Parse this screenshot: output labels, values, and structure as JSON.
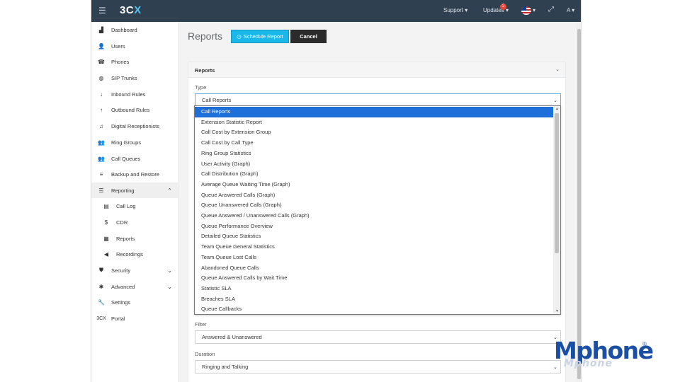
{
  "topbar": {
    "menu_icon": "hamburger-icon",
    "logo_main": "3C",
    "logo_x": "X",
    "support": "Support ▾",
    "updates": "Updates ▾",
    "updates_badge": "2",
    "language_caret": "▾",
    "fullscreen_icon": "⤢",
    "user": "A ▾"
  },
  "sidebar": {
    "items": [
      {
        "icon": "bar-chart-icon",
        "glyph": "▟",
        "label": "Dashboard"
      },
      {
        "icon": "user-icon",
        "glyph": "👤",
        "label": "Users"
      },
      {
        "icon": "phone-icon",
        "glyph": "☎",
        "label": "Phones"
      },
      {
        "icon": "globe-icon",
        "glyph": "◍",
        "label": "SIP Trunks"
      },
      {
        "icon": "arrow-down-icon",
        "glyph": "↓",
        "label": "Inbound Rules"
      },
      {
        "icon": "arrow-up-icon",
        "glyph": "↑",
        "label": "Outbound Rules"
      },
      {
        "icon": "headset-icon",
        "glyph": "♫",
        "label": "Digital Receptionists"
      },
      {
        "icon": "group-icon",
        "glyph": "👥",
        "label": "Ring Groups"
      },
      {
        "icon": "queue-icon",
        "glyph": "👥",
        "label": "Call Queues"
      },
      {
        "icon": "database-icon",
        "glyph": "≡",
        "label": "Backup and Restore"
      },
      {
        "icon": "list-icon",
        "glyph": "☰",
        "label": "Reporting",
        "chev": "⌃"
      },
      {
        "icon": "log-icon",
        "glyph": "▤",
        "label": "Call Log"
      },
      {
        "icon": "dollar-icon",
        "glyph": "$",
        "label": "CDR"
      },
      {
        "icon": "reports-icon",
        "glyph": "▦",
        "label": "Reports"
      },
      {
        "icon": "speaker-icon",
        "glyph": "◀",
        "label": "Recordings"
      },
      {
        "icon": "shield-icon",
        "glyph": "⛊",
        "label": "Security",
        "chev": "⌄"
      },
      {
        "icon": "cog-icon",
        "glyph": "✱",
        "label": "Advanced",
        "chev": "⌄"
      },
      {
        "icon": "wrench-icon",
        "glyph": "🔧",
        "label": "Settings"
      },
      {
        "icon": "3cx-icon",
        "glyph": "3CX",
        "label": "Portal"
      }
    ]
  },
  "header": {
    "title": "Reports",
    "schedule_button": "Schedule Report",
    "clock_glyph": "◷",
    "cancel_button": "Cancel"
  },
  "panel": {
    "title": "Reports",
    "chevron": "⌄",
    "type_label": "Type",
    "type_value": "Call Reports",
    "filter_label": "Filter",
    "filter_value": "Answered & Unanswered",
    "duration_label": "Duration",
    "duration_value": "Ringing and Talking",
    "caret": "⌄"
  },
  "dropdown": {
    "options": [
      "Call Reports",
      "Extension Statistic Report",
      "Call Cost by Extension Group",
      "Call Cost by Call Type",
      "Ring Group Statistics",
      "User Activity (Graph)",
      "Call Distribution (Graph)",
      "Average Queue Waiting Time (Graph)",
      "Queue Answered Calls (Graph)",
      "Queue Unanswered Calls (Graph)",
      "Queue Answered / Unanswered Calls (Graph)",
      "Queue Performance Overview",
      "Detailed Queue Statistics",
      "Team Queue General Statistics",
      "Team Queue Lost Calls",
      "Abandoned Queue Calls",
      "Queue Answered Calls by Wait Time",
      "Statistic SLA",
      "Breaches SLA",
      "Queue Callbacks"
    ],
    "selected": "Call Reports"
  },
  "watermark": {
    "text": "Mphone",
    "registered": "®",
    "reflection": "Mphone"
  },
  "colors": {
    "topbar": "#2f4050",
    "primary_button": "#1ab7ea",
    "selected_option": "#1e6fd9",
    "brand": "#1a4fa3"
  }
}
